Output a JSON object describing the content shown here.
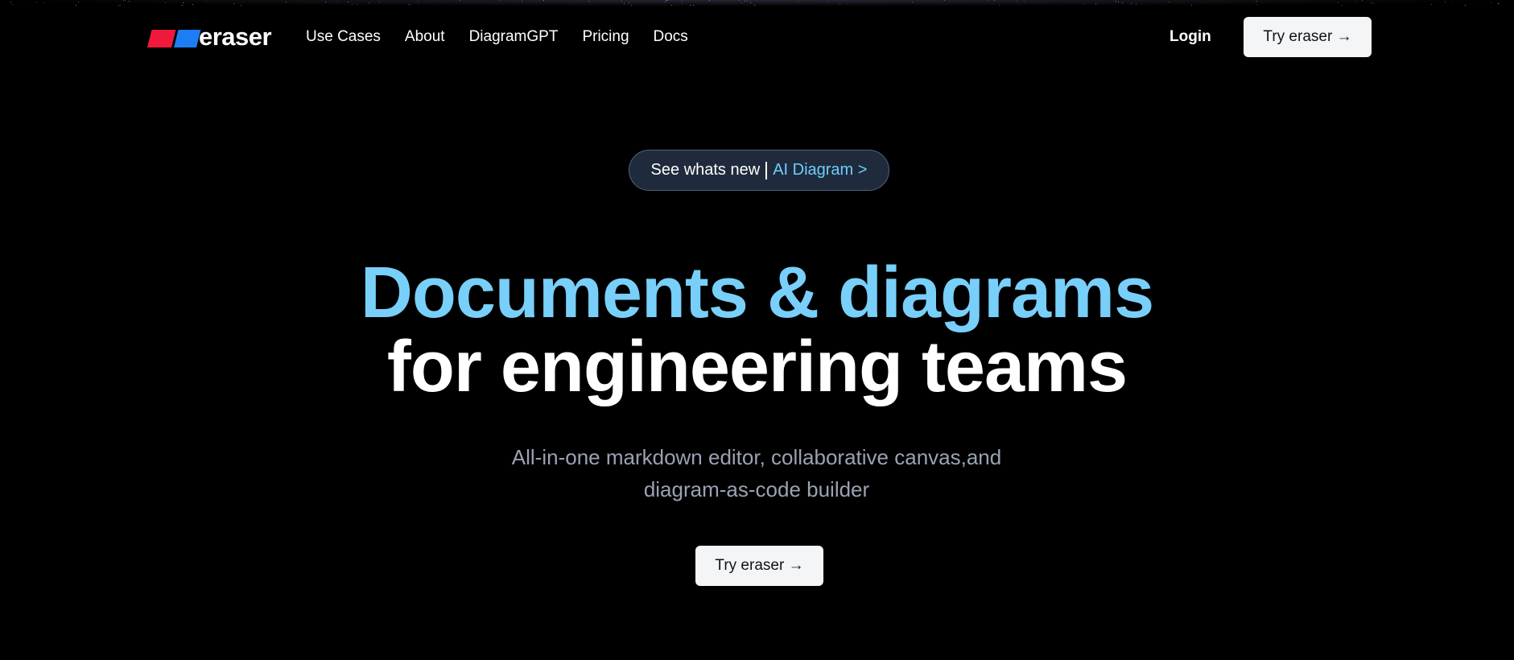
{
  "brand": {
    "name": "eraser",
    "mark_colors": [
      "#f0193c",
      "#1d7df2"
    ]
  },
  "nav": {
    "links": [
      "Use Cases",
      "About",
      "DiagramGPT",
      "Pricing",
      "Docs"
    ],
    "login_label": "Login",
    "cta_label": "Try eraser →"
  },
  "announcement": {
    "text": "See whats new",
    "link_text": "AI Diagram >"
  },
  "hero": {
    "headline_line1": "Documents & diagrams",
    "headline_line2": "for engineering teams",
    "subtitle_line1": "All-in-one markdown editor, collaborative canvas,and",
    "subtitle_line2": "diagram-as-code builder",
    "cta_label": "Try eraser →"
  },
  "colors": {
    "background": "#000000",
    "accent_blue": "#78cffa",
    "button_bg": "#f4f5f7",
    "pill_bg": "#1f2b3d",
    "subtitle": "#9aa2b3"
  }
}
